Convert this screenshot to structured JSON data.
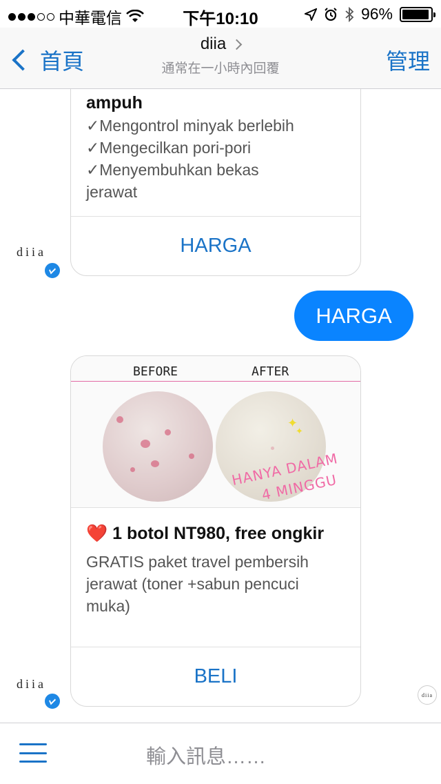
{
  "status_bar": {
    "carrier": "中華電信",
    "time": "下午10:10",
    "battery": "96%",
    "battery_level": 0.96,
    "icons": [
      "signal-dots",
      "wifi-icon",
      "location-icon",
      "alarm-icon",
      "bluetooth-icon",
      "battery-icon"
    ]
  },
  "nav": {
    "back_label": "首頁",
    "title": "diia",
    "subtitle": "通常在一小時內回覆",
    "manage_label": "管理"
  },
  "chat": {
    "card1": {
      "title": "ampuh",
      "lines": [
        "✓Mengontrol minyak berlebih",
        "✓Mengecilkan pori-pori",
        "✓Menyembuhkan bekas",
        "jerawat"
      ],
      "button": "HARGA"
    },
    "outgoing_message": "HARGA",
    "card2": {
      "image": {
        "before_label": "BEFORE",
        "after_label": "AFTER",
        "overlay_line1": "HANYA DALAM",
        "overlay_line2": "4 MINGGU"
      },
      "heart": "❤️",
      "title": "1 botol NT980, free ongkir",
      "description": "GRATIS paket travel pembersih jerawat (toner +sabun pencuci muka)",
      "button": "BELI"
    },
    "avatar_label": "diia",
    "seen_label": "diia"
  },
  "input": {
    "placeholder": "輸入訊息……"
  }
}
